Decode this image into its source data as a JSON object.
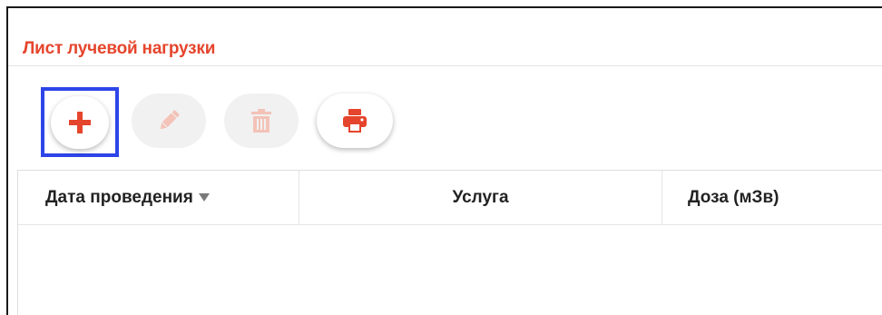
{
  "panel": {
    "title": "Лист лучевой нагрузки"
  },
  "toolbar": {
    "add": {
      "icon": "plus-icon",
      "enabled": true,
      "color": "#e5452c"
    },
    "edit": {
      "icon": "pencil-icon",
      "enabled": false,
      "color": "#f3c3b8"
    },
    "delete": {
      "icon": "trash-icon",
      "enabled": false,
      "color": "#f3c3b8"
    },
    "print": {
      "icon": "printer-icon",
      "enabled": true,
      "color": "#e5452c"
    }
  },
  "table": {
    "columns": [
      {
        "label": "Дата проведения",
        "sorted": "desc"
      },
      {
        "label": "Услуга"
      },
      {
        "label": "Доза (мЗв)"
      }
    ],
    "rows": []
  },
  "colors": {
    "accent": "#e5452c",
    "focus_outline": "#2d45e8"
  }
}
